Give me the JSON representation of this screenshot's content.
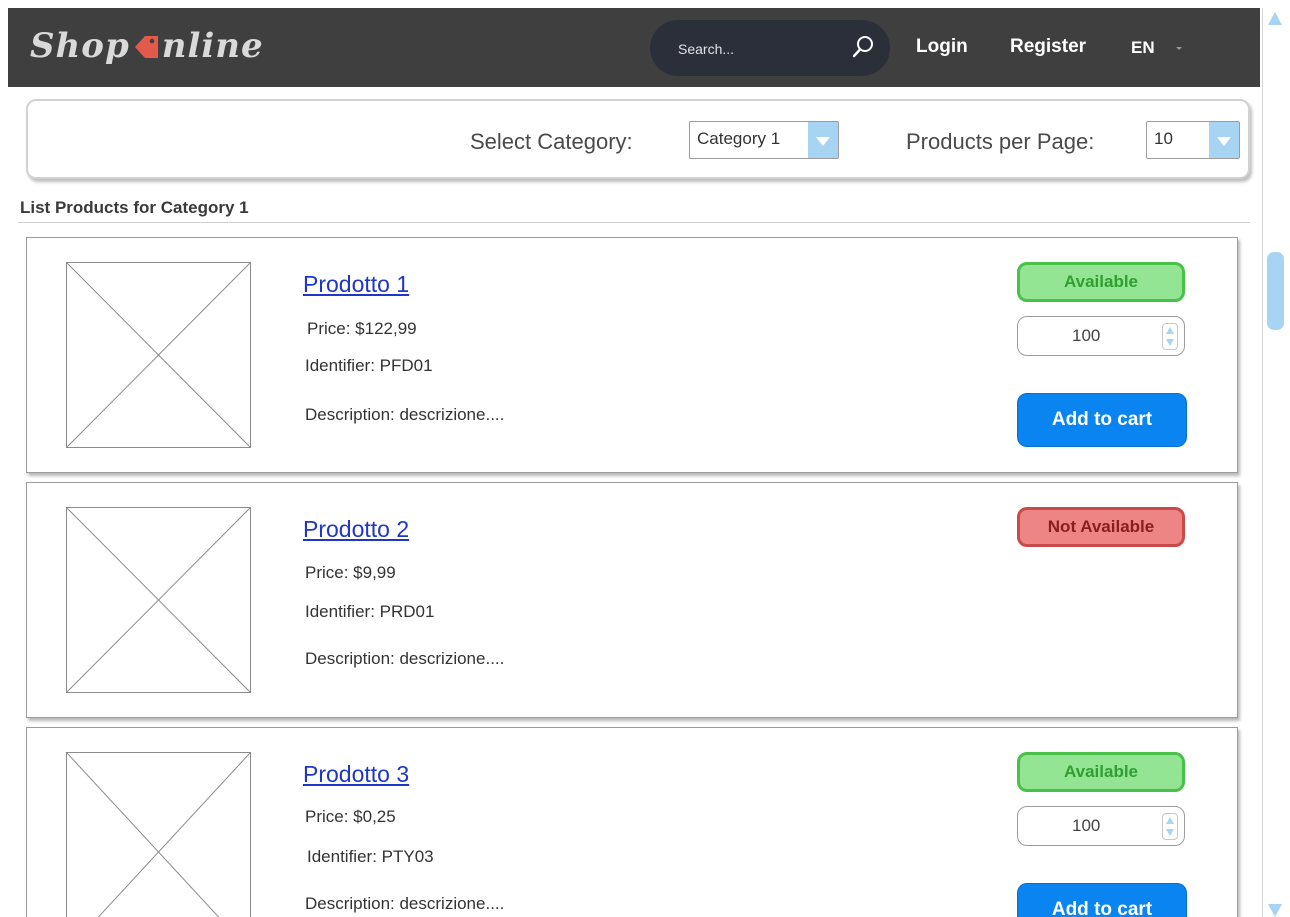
{
  "header": {
    "logo_left": "Shop",
    "logo_right": "nline",
    "search_placeholder": "Search...",
    "login_label": "Login",
    "register_label": "Register",
    "language": "EN"
  },
  "filters": {
    "category_label": "Select Category:",
    "category_value": "Category 1",
    "per_page_label": "Products per Page:",
    "per_page_value": "10"
  },
  "list_title": "List Products for Category 1",
  "products": [
    {
      "name": "Prodotto 1",
      "price": "Price: $122,99",
      "identifier": "Identifier: PFD01",
      "description": "Description: descrizione....",
      "status": "Available",
      "quantity": "100",
      "cart_label": "Add to cart"
    },
    {
      "name": "Prodotto 2",
      "price": "Price: $9,99",
      "identifier": "Identifier: PRD01",
      "description": "Description: descrizione....",
      "status": "Not Available"
    },
    {
      "name": "Prodotto 3",
      "price": "Price: $0,25",
      "identifier": "Identifier: PTY03",
      "description": "Description: descrizione....",
      "status": "Available",
      "quantity": "100",
      "cart_label": "Add to cart"
    }
  ],
  "colors": {
    "header_bg": "#3f3f3f",
    "accent_blue": "#0a84f0",
    "available_green": "#93e493",
    "unavailable_red": "#ee8585",
    "link_blue": "#1f36c8",
    "logo_tag": "#e35a4c"
  },
  "icons": [
    "price-tag-icon",
    "search-icon",
    "chevron-down-icon",
    "scroll-up-icon",
    "scroll-down-icon",
    "image-placeholder-icon",
    "spinner-icon"
  ]
}
